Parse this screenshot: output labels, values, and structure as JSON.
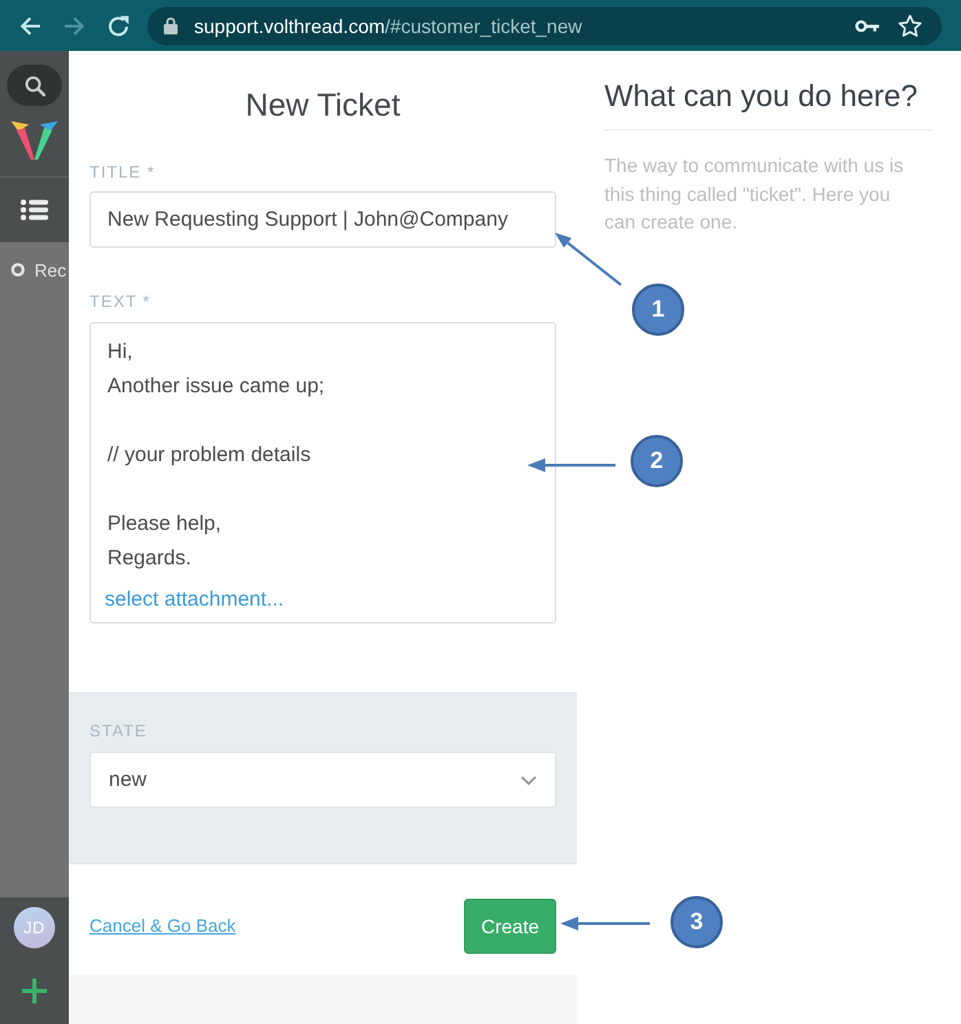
{
  "browser": {
    "nav_buttons": [
      {
        "kind": "back",
        "disabled": false
      },
      {
        "kind": "forward",
        "disabled": true
      },
      {
        "kind": "reload",
        "disabled": false
      }
    ],
    "url": {
      "host": "support.volthread.com",
      "path": "/#customer_ticket_new"
    }
  },
  "sidebar": {
    "items": [
      {
        "label": "Rec"
      }
    ],
    "avatar": {
      "initials": "JD"
    }
  },
  "form": {
    "heading": "New Ticket",
    "title_field": {
      "label": "TITLE *",
      "value": "New Requesting Support | John@Company"
    },
    "text_field": {
      "label": "TEXT *",
      "value": "Hi,\nAnother issue came up;\n\n// your problem details\n\nPlease help,\nRegards.",
      "attachment_link": "select attachment..."
    },
    "state_field": {
      "label": "STATE",
      "value": "new"
    },
    "cancel_link": "Cancel & Go Back",
    "create_button": "Create"
  },
  "help": {
    "heading": "What can you do here?",
    "text": "The way to communicate with us is this thing called \"ticket\". Here you can create one."
  },
  "callouts": [
    {
      "number": "1"
    },
    {
      "number": "2"
    },
    {
      "number": "3"
    }
  ]
}
